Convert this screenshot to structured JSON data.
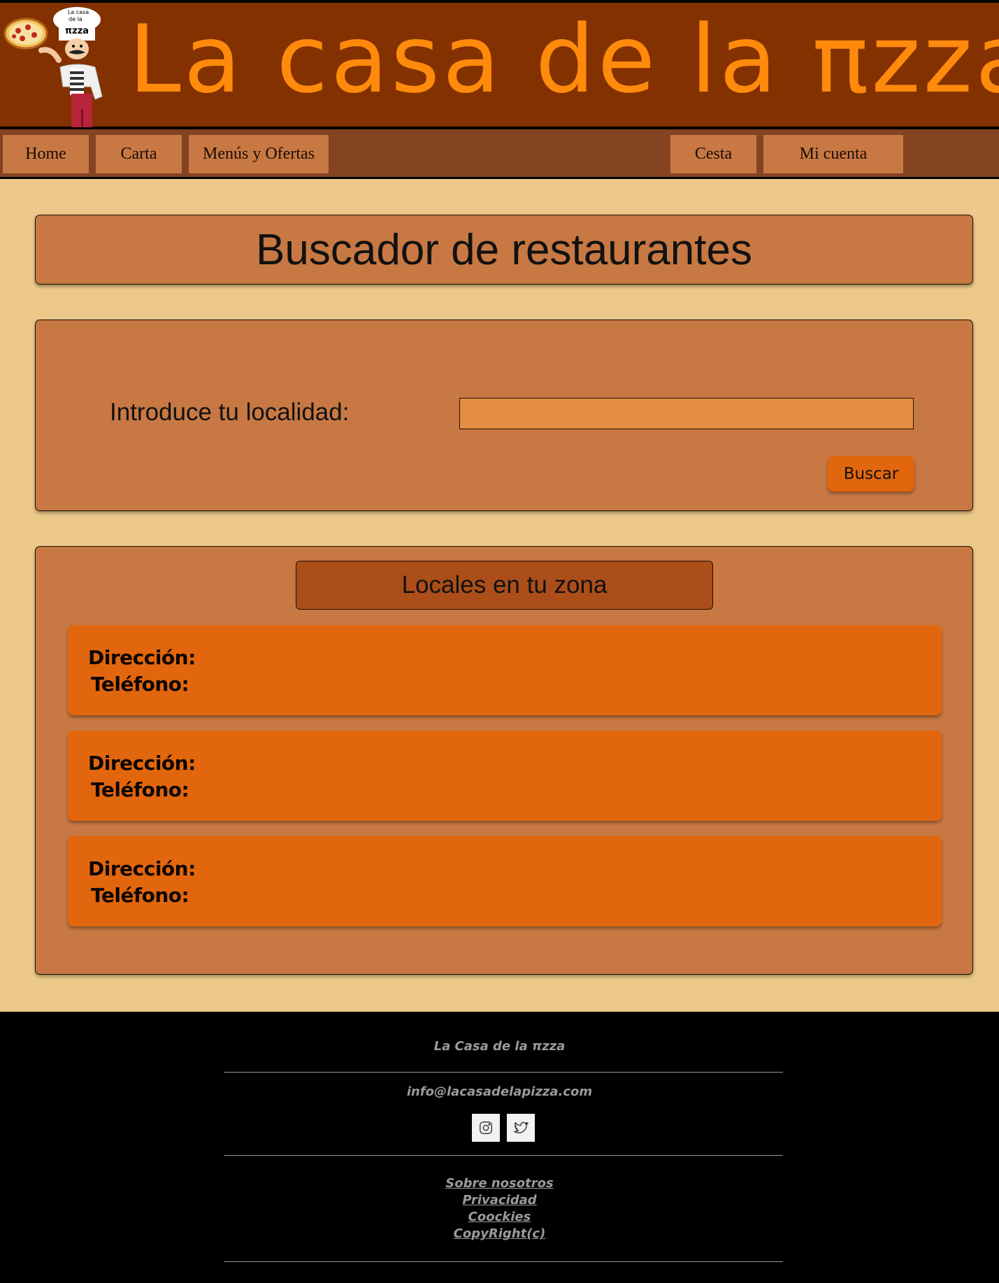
{
  "header": {
    "title": "La casa de la πzza",
    "logo": {
      "text_line1": "La casa",
      "text_line2": "de la",
      "text_line3": "πzza",
      "icon": "chef-with-pizza-icon"
    }
  },
  "nav": {
    "items": [
      "Home",
      "Carta",
      "Menús y Ofertas"
    ],
    "right_items": [
      "Cesta",
      "Mi cuenta"
    ]
  },
  "search": {
    "title": "Buscador de restaurantes",
    "label": "Introduce tu localidad:",
    "input_value": "",
    "button": "Buscar"
  },
  "results": {
    "heading": "Locales en tu zona",
    "cards": [
      {
        "address_label": "Dirección:",
        "phone_label": "Teléfono:"
      },
      {
        "address_label": "Dirección:",
        "phone_label": "Teléfono:"
      },
      {
        "address_label": "Dirección:",
        "phone_label": "Teléfono:"
      }
    ]
  },
  "footer": {
    "brand": "La Casa de la  πzza",
    "email": "info@lacasadelapizza.com",
    "social": [
      "instagram-icon",
      "twitter-icon"
    ],
    "links": [
      "Sobre nosotros",
      "Privacidad",
      "Coockies",
      "CopyRight(c)"
    ]
  },
  "colors": {
    "header_bg": "#833100",
    "title": "#ff8a0c",
    "nav_bg": "#844321",
    "nav_button": "#c87843",
    "page_bg": "#ecc98a",
    "panel": "#c87843",
    "card": "#e2660d",
    "footer_bg": "#000000"
  }
}
